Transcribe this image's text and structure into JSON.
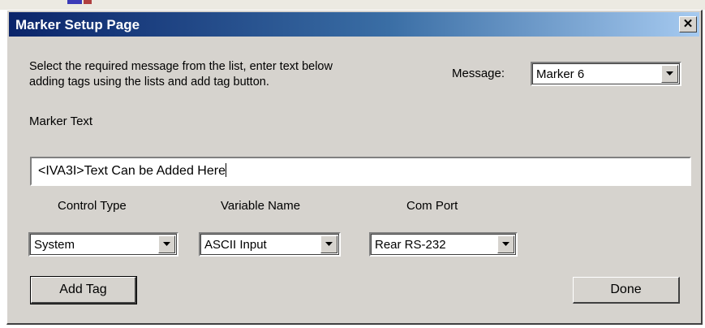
{
  "window": {
    "title": "Marker Setup Page",
    "close_glyph": "✕"
  },
  "instructions": {
    "line1": "Select the required message from the list, enter text below",
    "line2": "adding tags using the lists and add tag button."
  },
  "message": {
    "label": "Message:",
    "value": "Marker 6"
  },
  "marker_text": {
    "label": "Marker Text",
    "value": "<IVA3I>Text Can be Added Here"
  },
  "control_type": {
    "label": "Control Type",
    "value": "System"
  },
  "variable_name": {
    "label": "Variable Name",
    "value": "ASCII Input"
  },
  "com_port": {
    "label": "Com Port",
    "value": "Rear RS-232"
  },
  "buttons": {
    "add_tag": "Add Tag",
    "done": "Done"
  },
  "icons": {
    "close": "close-icon",
    "dropdown": "chevron-down-icon"
  },
  "colors": {
    "title_gradient_start": "#0a246a",
    "title_gradient_end": "#a6caf0",
    "dialog_face": "#d6d3ce"
  }
}
